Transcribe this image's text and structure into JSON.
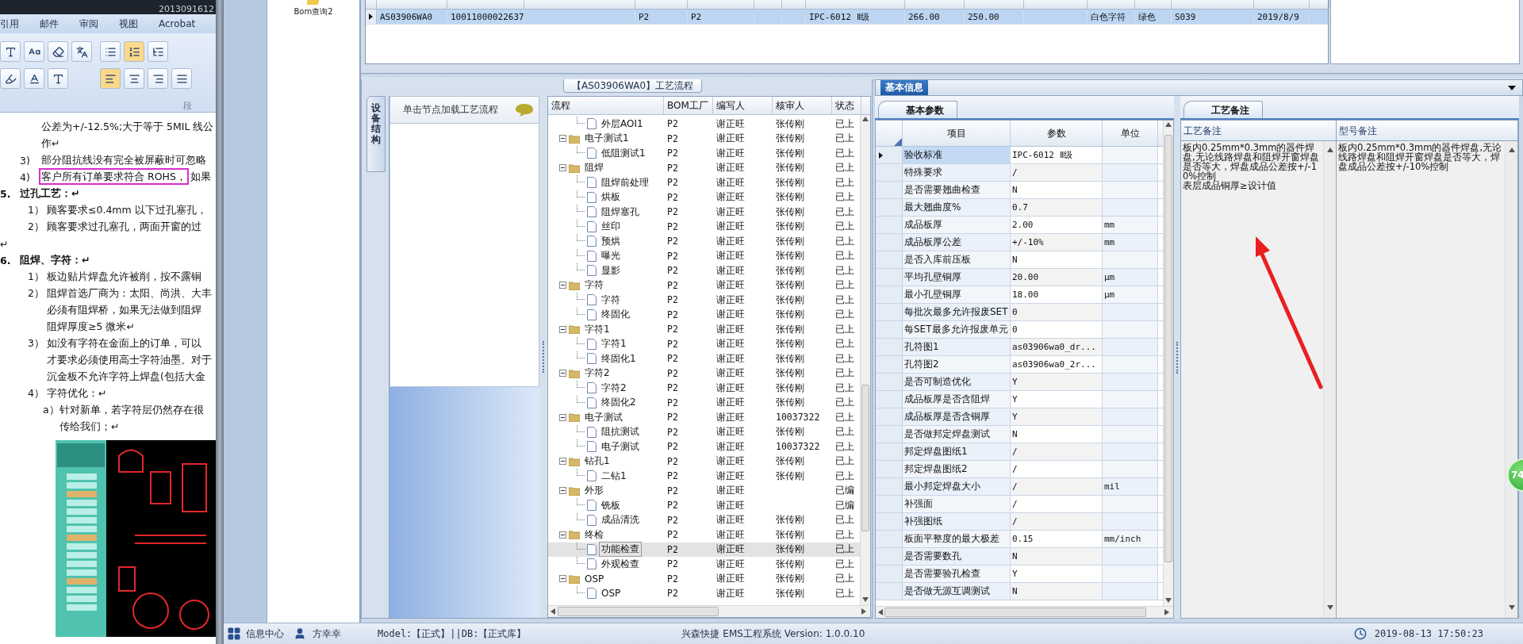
{
  "word": {
    "title": "2013091612",
    "ribbon_tabs": [
      "引用",
      "邮件",
      "审阅",
      "视图",
      "Acrobat"
    ],
    "group_label": "段",
    "lines": [
      {
        "kind": "cont",
        "text": "公差为+/-12.5%;大于等于 5MIL 线公"
      },
      {
        "kind": "cont",
        "text": "作↵"
      },
      {
        "kind": "item",
        "marker": "3)",
        "text": "部分阻抗线没有完全被屏蔽时可忽略"
      },
      {
        "kind": "item",
        "marker": "4)",
        "highlight": "客户所有订单要求符合 ROHS，",
        "text": "如果"
      },
      {
        "kind": "heading",
        "marker": "5.",
        "text": "过孔工艺：↵"
      },
      {
        "kind": "sub",
        "marker": "1）",
        "text": "顾客要求≤0.4mm 以下过孔塞孔，"
      },
      {
        "kind": "sub",
        "marker": "2）",
        "text": "顾客要求过孔塞孔，两面开窗的过"
      },
      {
        "kind": "blank",
        "text": "↵"
      },
      {
        "kind": "heading",
        "marker": "6.",
        "text": "阻焊、字符：↵"
      },
      {
        "kind": "sub",
        "marker": "1）",
        "text": "板边贴片焊盘允许被削，按不露铜"
      },
      {
        "kind": "sub",
        "marker": "2）",
        "text": "阻焊首选厂商为：太阳、尚洪、大丰"
      },
      {
        "kind": "subcont",
        "text": "必须有阻焊桥，如果无法做到阻焊"
      },
      {
        "kind": "subcont",
        "text": "阻焊厚度≥5 微米↵"
      },
      {
        "kind": "sub",
        "marker": "3）",
        "text": "如没有字符在金面上的订单，可以"
      },
      {
        "kind": "subcont",
        "text": "才要求必须使用高士字符油墨。对于"
      },
      {
        "kind": "subcont",
        "text": "沉金板不允许字符上焊盘(包括大金"
      },
      {
        "kind": "sub",
        "marker": "4）",
        "text": "字符优化：↵"
      },
      {
        "kind": "alpha",
        "marker": "a）",
        "text": "针对新单，若字符层仍然存在很"
      },
      {
        "kind": "alphacont",
        "text": "传给我们；↵"
      }
    ]
  },
  "sidebar": {
    "items": [
      {
        "label": "Bom查询2"
      }
    ]
  },
  "order_grid": {
    "rows": [
      {
        "selected": true,
        "column_1": "AS03906WA0",
        "column_2": "10011000022637",
        "column_4": "P2",
        "column_5": "P2",
        "column_8": "IPC-6012 Ⅱ级",
        "column_9": "266.00",
        "column_10": "250.00",
        "column_12": "白色字符",
        "column_13": "绿色",
        "column_14": "S039",
        "column_15": "2019/8/9"
      }
    ]
  },
  "flow_panel": {
    "title": "【AS03906WA0】工艺流程",
    "side_tab": "设备结构",
    "hint": "单击节点加载工艺流程",
    "columns": [
      "流程",
      "BOM工厂",
      "编写人",
      "核审人",
      "状态"
    ],
    "tree": [
      {
        "kind": "step",
        "label": "外层AOI1",
        "factory": "P2",
        "writer": "谢正旺",
        "reviewer": "张传刚",
        "status": "已上",
        "selected": false
      },
      {
        "kind": "group",
        "label": "电子测试1",
        "expanded": true,
        "factory": "P2",
        "writer": "谢正旺",
        "reviewer": "张传刚",
        "status": "已上",
        "selected": false,
        "children": [
          {
            "kind": "step",
            "label": "低阻测试1",
            "factory": "P2",
            "writer": "谢正旺",
            "reviewer": "张传刚",
            "status": "已上",
            "selected": false
          }
        ]
      },
      {
        "kind": "group",
        "label": "阻焊",
        "expanded": true,
        "factory": "P2",
        "writer": "谢正旺",
        "reviewer": "张传刚",
        "status": "已上",
        "selected": false,
        "children": [
          {
            "kind": "step",
            "label": "阻焊前处理",
            "factory": "P2",
            "writer": "谢正旺",
            "reviewer": "张传刚",
            "status": "已上",
            "selected": false
          },
          {
            "kind": "step",
            "label": "烘板",
            "factory": "P2",
            "writer": "谢正旺",
            "reviewer": "张传刚",
            "status": "已上",
            "selected": false
          },
          {
            "kind": "step",
            "label": "阻焊塞孔",
            "factory": "P2",
            "writer": "谢正旺",
            "reviewer": "张传刚",
            "status": "已上",
            "selected": false
          },
          {
            "kind": "step",
            "label": "丝印",
            "factory": "P2",
            "writer": "谢正旺",
            "reviewer": "张传刚",
            "status": "已上",
            "selected": false
          },
          {
            "kind": "step",
            "label": "预烘",
            "factory": "P2",
            "writer": "谢正旺",
            "reviewer": "张传刚",
            "status": "已上",
            "selected": false
          },
          {
            "kind": "step",
            "label": "曝光",
            "factory": "P2",
            "writer": "谢正旺",
            "reviewer": "张传刚",
            "status": "已上",
            "selected": false
          },
          {
            "kind": "step",
            "label": "显影",
            "factory": "P2",
            "writer": "谢正旺",
            "reviewer": "张传刚",
            "status": "已上",
            "selected": false
          }
        ]
      },
      {
        "kind": "group",
        "label": "字符",
        "expanded": true,
        "factory": "P2",
        "writer": "谢正旺",
        "reviewer": "张传刚",
        "status": "已上",
        "selected": false,
        "children": [
          {
            "kind": "step",
            "label": "字符",
            "factory": "P2",
            "writer": "谢正旺",
            "reviewer": "张传刚",
            "status": "已上",
            "selected": false
          },
          {
            "kind": "step",
            "label": "终固化",
            "factory": "P2",
            "writer": "谢正旺",
            "reviewer": "张传刚",
            "status": "已上",
            "selected": false
          }
        ]
      },
      {
        "kind": "group",
        "label": "字符1",
        "expanded": true,
        "factory": "P2",
        "writer": "谢正旺",
        "reviewer": "张传刚",
        "status": "已上",
        "selected": false,
        "children": [
          {
            "kind": "step",
            "label": "字符1",
            "factory": "P2",
            "writer": "谢正旺",
            "reviewer": "张传刚",
            "status": "已上",
            "selected": false
          },
          {
            "kind": "step",
            "label": "终固化1",
            "factory": "P2",
            "writer": "谢正旺",
            "reviewer": "张传刚",
            "status": "已上",
            "selected": false
          }
        ]
      },
      {
        "kind": "group",
        "label": "字符2",
        "expanded": true,
        "factory": "P2",
        "writer": "谢正旺",
        "reviewer": "张传刚",
        "status": "已上",
        "selected": false,
        "children": [
          {
            "kind": "step",
            "label": "字符2",
            "factory": "P2",
            "writer": "谢正旺",
            "reviewer": "张传刚",
            "status": "已上",
            "selected": false
          },
          {
            "kind": "step",
            "label": "终固化2",
            "factory": "P2",
            "writer": "谢正旺",
            "reviewer": "张传刚",
            "status": "已上",
            "selected": false
          }
        ]
      },
      {
        "kind": "group",
        "label": "电子测试",
        "expanded": true,
        "factory": "P2",
        "writer": "谢正旺",
        "reviewer": "10037322",
        "status": "已上",
        "selected": false,
        "children": [
          {
            "kind": "step",
            "label": "阻抗测试",
            "factory": "P2",
            "writer": "谢正旺",
            "reviewer": "张传刚",
            "status": "已上",
            "selected": false
          },
          {
            "kind": "step",
            "label": "电子测试",
            "factory": "P2",
            "writer": "谢正旺",
            "reviewer": "10037322",
            "status": "已上",
            "selected": false
          }
        ]
      },
      {
        "kind": "group",
        "label": "钻孔1",
        "expanded": true,
        "factory": "P2",
        "writer": "谢正旺",
        "reviewer": "张传刚",
        "status": "已上",
        "selected": false,
        "children": [
          {
            "kind": "step",
            "label": "二钻1",
            "factory": "P2",
            "writer": "谢正旺",
            "reviewer": "张传刚",
            "status": "已上",
            "selected": false
          }
        ]
      },
      {
        "kind": "group",
        "label": "外形",
        "expanded": true,
        "factory": "P2",
        "writer": "谢正旺",
        "status": "已编",
        "selected": false,
        "children": [
          {
            "kind": "step",
            "label": "铣板",
            "factory": "P2",
            "writer": "谢正旺",
            "status": "已编",
            "selected": false
          },
          {
            "kind": "step",
            "label": "成品清洗",
            "factory": "P2",
            "writer": "谢正旺",
            "reviewer": "张传刚",
            "status": "已上",
            "selected": false
          }
        ]
      },
      {
        "kind": "group",
        "label": "终检",
        "expanded": true,
        "factory": "P2",
        "writer": "谢正旺",
        "reviewer": "张传刚",
        "status": "已上",
        "selected": false,
        "children": [
          {
            "kind": "step",
            "label": "功能检查",
            "factory": "P2",
            "writer": "谢正旺",
            "reviewer": "张传刚",
            "status": "已上",
            "selected": true
          },
          {
            "kind": "step",
            "label": "外观检查",
            "factory": "P2",
            "writer": "谢正旺",
            "reviewer": "张传刚",
            "status": "已上",
            "selected": false
          }
        ]
      },
      {
        "kind": "group",
        "label": "OSP",
        "expanded": true,
        "factory": "P2",
        "writer": "谢正旺",
        "reviewer": "张传刚",
        "status": "已上",
        "selected": false,
        "children": [
          {
            "kind": "step",
            "label": "OSP",
            "factory": "P2",
            "writer": "谢正旺",
            "reviewer": "张传刚",
            "status": "已上",
            "selected": false
          }
        ]
      }
    ]
  },
  "info_panel": {
    "title": "基本信息",
    "params_tab": "基本参数",
    "columns": [
      "项目",
      "参数",
      "单位"
    ],
    "rows": [
      {
        "item": "验收标准",
        "value": "IPC-6012 Ⅱ级",
        "selected": true
      },
      {
        "item": "特殊要求",
        "value": "/",
        "selected": false
      },
      {
        "item": "是否需要翘曲检查",
        "value": "N",
        "selected": false
      },
      {
        "item": "最大翘曲度%",
        "value": "0.7",
        "selected": false
      },
      {
        "item": "成品板厚",
        "value": "2.00",
        "unit": "mm",
        "selected": false
      },
      {
        "item": "成品板厚公差",
        "value": "+/-10%",
        "unit": "mm",
        "selected": false
      },
      {
        "item": "是否入库前压板",
        "value": "N",
        "selected": false
      },
      {
        "item": "平均孔壁铜厚",
        "value": "20.00",
        "unit": "μm",
        "selected": false
      },
      {
        "item": "最小孔壁铜厚",
        "value": "18.00",
        "unit": "μm",
        "selected": false
      },
      {
        "item": "每批次最多允许报废SET",
        "value": "0",
        "selected": false
      },
      {
        "item": "每SET最多允许报废单元",
        "value": "0",
        "selected": false
      },
      {
        "item": "孔符图1",
        "value": "as03906wa0_dr...",
        "selected": false
      },
      {
        "item": "孔符图2",
        "value": "as03906wa0_2r...",
        "selected": false
      },
      {
        "item": "是否可制造优化",
        "value": "Y",
        "selected": false
      },
      {
        "item": "成品板厚是否含阻焊",
        "value": "Y",
        "selected": false
      },
      {
        "item": "成品板厚是否含铜厚",
        "value": "Y",
        "selected": false
      },
      {
        "item": "是否做邦定焊盘测试",
        "value": "N",
        "selected": false
      },
      {
        "item": "邦定焊盘图纸1",
        "value": "/",
        "selected": false
      },
      {
        "item": "邦定焊盘图纸2",
        "value": "/",
        "selected": false
      },
      {
        "item": "最小邦定焊盘大小",
        "value": "/",
        "unit": "mil",
        "selected": false
      },
      {
        "item": "补强面",
        "value": "/",
        "selected": false
      },
      {
        "item": "补强图纸",
        "value": "/",
        "selected": false
      },
      {
        "item": "板面平整度的最大极差",
        "value": "0.15",
        "unit": "mm/inch",
        "selected": false
      },
      {
        "item": "是否需要数孔",
        "value": "N",
        "selected": false
      },
      {
        "item": "是否需要验孔检查",
        "value": "Y",
        "selected": false
      },
      {
        "item": "是否做无源互调测试",
        "value": "N",
        "selected": false
      }
    ],
    "notes_tab": "工艺备注",
    "notes": [
      {
        "header": "工艺备注",
        "paragraphs": [
          "板内0.25mm*0.3mm的器件焊盘,无论线路焊盘和阻焊开窗焊盘是否等大，焊盘成品公差按+/-10%控制",
          "表层成品铜厚≥设计值"
        ]
      },
      {
        "header": "型号备注",
        "paragraphs": [
          "板内0.25mm*0.3mm的器件焊盘,无论线路焊盘和阻焊开窗焊盘是否等大，焊盘成品公差按+/-10%控制"
        ]
      }
    ]
  },
  "status_bar": {
    "info": "信息中心",
    "user": "方幸幸",
    "model": "Model:【正式】||DB:【正式库】",
    "app": "兴森快捷 EMS工程系统 Version: 1.0.0.10",
    "time": "2019-08-13 17:50:23"
  },
  "badge": "74"
}
